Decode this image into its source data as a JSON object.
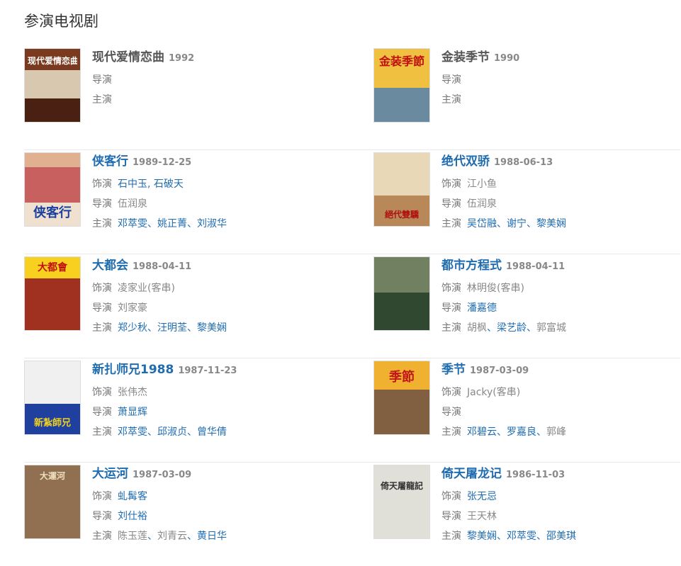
{
  "section_title": "参演电视剧",
  "labels": {
    "role": "饰演",
    "director": "导演",
    "cast": "主演"
  },
  "shows": [
    {
      "title": "现代爱情恋曲",
      "year": "1992",
      "linked": false,
      "role": null,
      "director": [],
      "cast": [],
      "cover_text": "现代爱情恋曲"
    },
    {
      "title": "金装季节",
      "year": "1990",
      "linked": false,
      "role": null,
      "director": [],
      "cast": [],
      "cover_text": "金装季節"
    },
    {
      "title": "侠客行",
      "year": "1989-12-25",
      "linked": true,
      "role": {
        "text": "石中玉, 石破天",
        "linked": true
      },
      "director": [
        {
          "name": "伍润泉",
          "linked": false
        }
      ],
      "cast": [
        {
          "name": "邓萃雯",
          "linked": true
        },
        {
          "name": "姚正菁",
          "linked": true
        },
        {
          "name": "刘淑华",
          "linked": true
        }
      ],
      "cover_text": "侠客行"
    },
    {
      "title": "绝代双骄",
      "year": "1988-06-13",
      "linked": true,
      "role": {
        "text": "江小鱼",
        "linked": false
      },
      "director": [
        {
          "name": "伍润泉",
          "linked": false
        }
      ],
      "cast": [
        {
          "name": "吴岱融",
          "linked": true
        },
        {
          "name": "谢宁",
          "linked": true
        },
        {
          "name": "黎美娴",
          "linked": true
        }
      ],
      "cover_text": "絕代雙驕"
    },
    {
      "title": "大都会",
      "year": "1988-04-11",
      "linked": true,
      "role": {
        "text": "凌家业(客串)",
        "linked": false
      },
      "director": [
        {
          "name": "刘家豪",
          "linked": false
        }
      ],
      "cast": [
        {
          "name": "郑少秋",
          "linked": true
        },
        {
          "name": "汪明荃",
          "linked": true
        },
        {
          "name": "黎美娴",
          "linked": true
        }
      ],
      "cover_text": "大都會"
    },
    {
      "title": "都市方程式",
      "year": "1988-04-11",
      "linked": true,
      "role": {
        "text": "林明俊(客串)",
        "linked": false
      },
      "director": [
        {
          "name": "潘嘉德",
          "linked": true
        }
      ],
      "cast": [
        {
          "name": "胡枫",
          "linked": false
        },
        {
          "name": "梁艺龄",
          "linked": true
        },
        {
          "name": "郭富城",
          "linked": false
        }
      ],
      "cover_text": ""
    },
    {
      "title": "新扎师兄1988",
      "year": "1987-11-23",
      "linked": true,
      "role": {
        "text": "张伟杰",
        "linked": false
      },
      "director": [
        {
          "name": "萧显辉",
          "linked": true
        }
      ],
      "cast": [
        {
          "name": "邓萃雯",
          "linked": true
        },
        {
          "name": "邱淑贞",
          "linked": true
        },
        {
          "name": "曾华倩",
          "linked": true
        }
      ],
      "cover_text": "新紮師兄"
    },
    {
      "title": "季节",
      "year": "1987-03-09",
      "linked": true,
      "role": {
        "text": "Jacky(客串)",
        "linked": false
      },
      "director": [],
      "cast": [
        {
          "name": "邓碧云",
          "linked": true
        },
        {
          "name": "罗嘉良",
          "linked": true
        },
        {
          "name": "郭峰",
          "linked": false
        }
      ],
      "cover_text": "季節"
    },
    {
      "title": "大运河",
      "year": "1987-03-09",
      "linked": true,
      "role": {
        "text": "虬髯客",
        "linked": true
      },
      "director": [
        {
          "name": "刘仕裕",
          "linked": true
        }
      ],
      "cast": [
        {
          "name": "陈玉莲",
          "linked": false
        },
        {
          "name": "刘青云",
          "linked": false
        },
        {
          "name": "黄日华",
          "linked": true
        }
      ],
      "cover_text": "大運河"
    },
    {
      "title": "倚天屠龙记",
      "year": "1986-11-03",
      "linked": true,
      "role": {
        "text": "张无忌",
        "linked": true
      },
      "director": [
        {
          "name": "王天林",
          "linked": false
        }
      ],
      "cast": [
        {
          "name": "黎美娴",
          "linked": true
        },
        {
          "name": "邓萃雯",
          "linked": true
        },
        {
          "name": "邵美琪",
          "linked": true
        }
      ],
      "cover_text": "倚天屠龍記"
    }
  ]
}
